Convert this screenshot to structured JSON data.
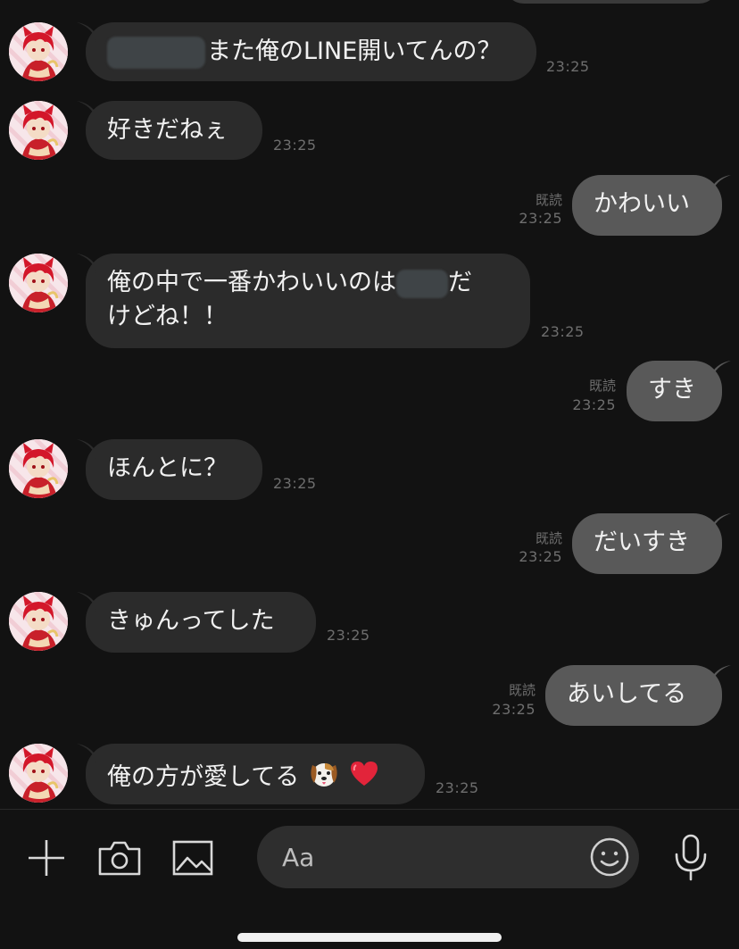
{
  "messages": [
    {
      "side": "in",
      "text": "また俺のLINE開いてんの？",
      "time": "23:25"
    },
    {
      "side": "in",
      "text": "好きだねぇ",
      "time": "23:25"
    },
    {
      "side": "out",
      "text": "かわいい",
      "time": "23:25",
      "read": "既読"
    },
    {
      "side": "in",
      "text_line1_start": "俺の中で一番かわいいのは",
      "text_line1_end": "だ",
      "text_line2": "けどね！！",
      "time": "23:25"
    },
    {
      "side": "out",
      "text": "すき",
      "time": "23:25",
      "read": "既読"
    },
    {
      "side": "in",
      "text": "ほんとに？",
      "time": "23:25"
    },
    {
      "side": "out",
      "text": "だいすき",
      "time": "23:25",
      "read": "既読"
    },
    {
      "side": "in",
      "text": "きゅんってした",
      "time": "23:25"
    },
    {
      "side": "out",
      "text": "あいしてる",
      "time": "23:25",
      "read": "既読"
    },
    {
      "side": "in",
      "text": "俺の方が愛してる",
      "time": "23:25",
      "emojis": [
        "dog-face-emoji",
        "red-heart-emoji"
      ]
    }
  ],
  "input": {
    "placeholder": "Aa"
  },
  "icons": [
    "plus-icon",
    "camera-icon",
    "image-icon",
    "smiley-icon",
    "microphone-icon"
  ],
  "colors": {
    "background": "#121212",
    "incoming_bubble": "#2b2b2b",
    "outgoing_bubble": "#595959",
    "meta_text": "#6e6e6e"
  }
}
